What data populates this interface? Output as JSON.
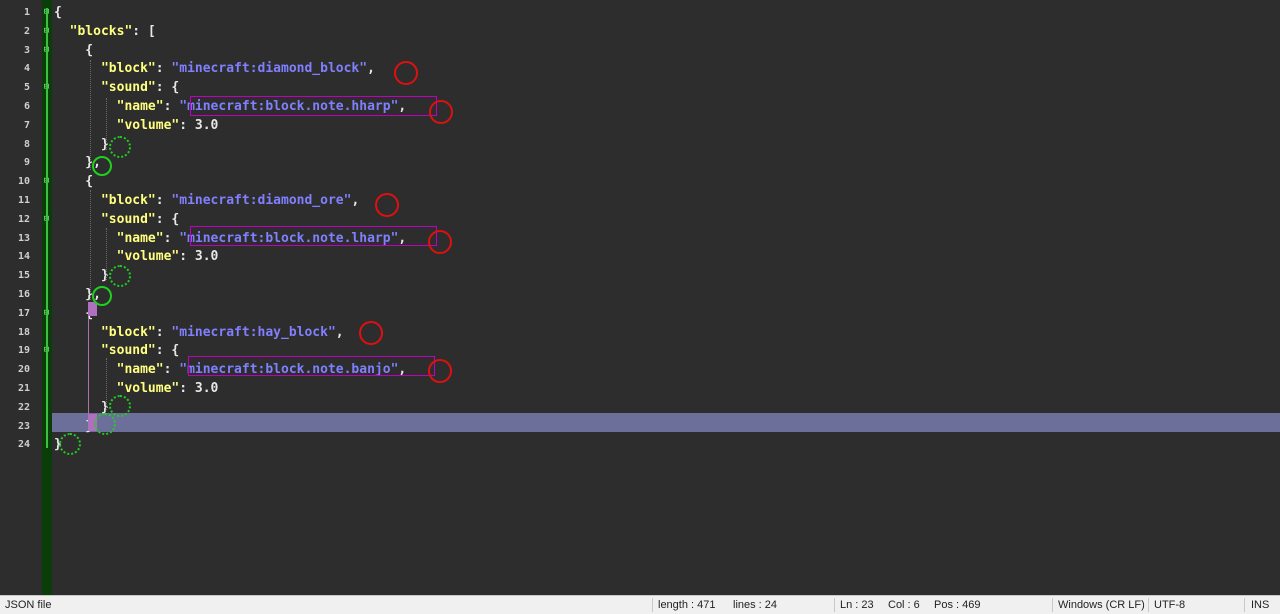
{
  "editor": {
    "lines": [
      {
        "n": "1",
        "t": "{"
      },
      {
        "n": "2",
        "t": "  \"blocks\": ["
      },
      {
        "n": "3",
        "t": "    {"
      },
      {
        "n": "4",
        "t": "      \"block\": \"minecraft:diamond_block\","
      },
      {
        "n": "5",
        "t": "      \"sound\": {"
      },
      {
        "n": "6",
        "t": "        \"name\": \"minecraft:block.note.hharp\","
      },
      {
        "n": "7",
        "t": "        \"volume\": 3.0"
      },
      {
        "n": "8",
        "t": "      }"
      },
      {
        "n": "9",
        "t": "    },"
      },
      {
        "n": "10",
        "t": "    {"
      },
      {
        "n": "11",
        "t": "      \"block\": \"minecraft:diamond_ore\","
      },
      {
        "n": "12",
        "t": "      \"sound\": {"
      },
      {
        "n": "13",
        "t": "        \"name\": \"minecraft:block.note.lharp\","
      },
      {
        "n": "14",
        "t": "        \"volume\": 3.0"
      },
      {
        "n": "15",
        "t": "      }"
      },
      {
        "n": "16",
        "t": "    },"
      },
      {
        "n": "17",
        "t": "    {"
      },
      {
        "n": "18",
        "t": "      \"block\": \"minecraft:hay_block\","
      },
      {
        "n": "19",
        "t": "      \"sound\": {"
      },
      {
        "n": "20",
        "t": "        \"name\": \"minecraft:block.note.banjo\","
      },
      {
        "n": "21",
        "t": "        \"volume\": 3.0"
      },
      {
        "n": "22",
        "t": "      }"
      },
      {
        "n": "23",
        "t": "    }"
      },
      {
        "n": "24",
        "t": "}"
      }
    ]
  },
  "status": {
    "file_type": "JSON file",
    "length": "length : 471",
    "lines": "lines : 24",
    "ln": "Ln : 23",
    "col": "Col : 6",
    "pos": "Pos : 469",
    "eol": "Windows (CR LF)",
    "encoding": "UTF-8",
    "mode": "INS"
  },
  "colors": {
    "background": "#2d2d2d",
    "key": "#ffff80",
    "string": "#8080ff",
    "current_line": "#6b6f9a",
    "annotation_red": "#e01010",
    "annotation_green": "#20d020"
  }
}
